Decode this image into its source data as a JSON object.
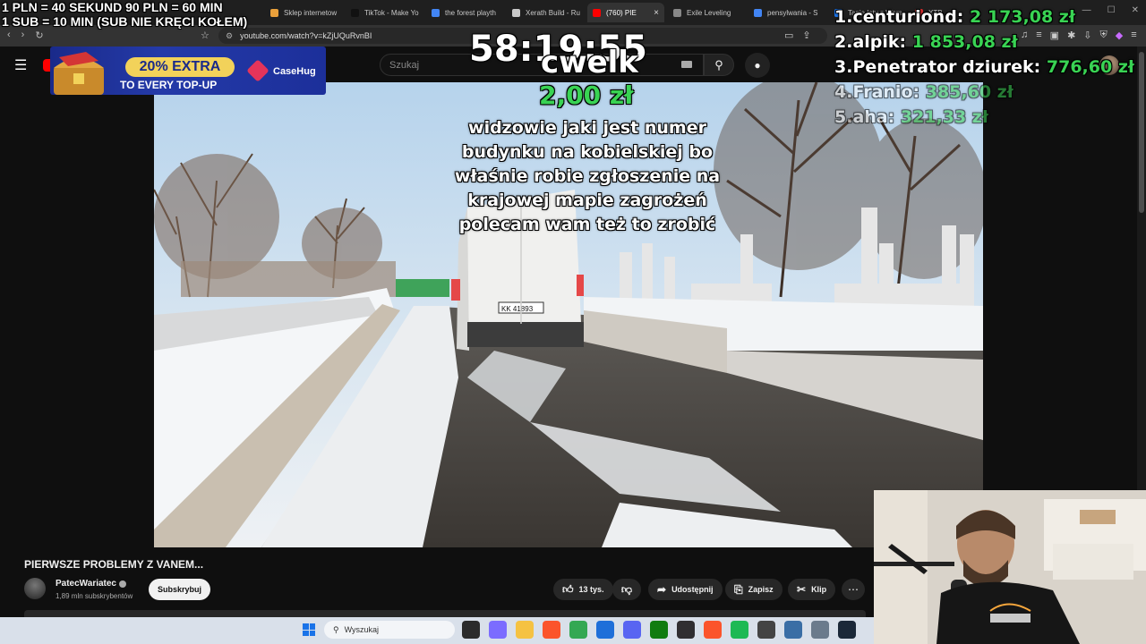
{
  "overlay": {
    "rate_line_1": "1 PLN =  40 SEKUND 90 PLN = 60 MIN",
    "rate_line_2": "1 SUB = 10 MIN (SUB NIE KRĘCI KOŁEM)",
    "timer": "58:19:55",
    "donation": {
      "name": "cwelk",
      "amount": "2,00 zł",
      "message": "widzowie jaki jest numer budynku na kobielskiej bo właśnie robie zgłoszenie na krajowej mapie zagrożeń polecam wam też to zrobić"
    },
    "leaderboard": [
      {
        "rank": "1.",
        "name": "centuriond:",
        "amount": "2 173,08 zł"
      },
      {
        "rank": "2.",
        "name": "alpik:",
        "amount": "1 853,08 zł"
      },
      {
        "rank": "3.",
        "name": "Penetrator dziurek:",
        "amount": "776,60 zł"
      },
      {
        "rank": "4.",
        "name": "Franio:",
        "amount": "385,60 zł"
      },
      {
        "rank": "5.",
        "name": "aha:",
        "amount": "321,33 zł"
      }
    ]
  },
  "browser": {
    "tabs": [
      {
        "label": "Sklep internetow",
        "color": "#e9a03b"
      },
      {
        "label": "TikTok - Make Yo",
        "color": "#111111"
      },
      {
        "label": "the forest playth",
        "color": "#4285f4"
      },
      {
        "label": "Xerath Build - Ru",
        "color": "#c9c9c9"
      },
      {
        "label": "(760) PIE",
        "color": "#ff0000",
        "active": true
      },
      {
        "label": "Exile Leveling",
        "color": "#888888"
      },
      {
        "label": "pensylwania - S",
        "color": "#4285f4"
      },
      {
        "label": "Tanie loty z Wars",
        "color": "#1a73e8"
      },
      {
        "label": "XTB",
        "color": "#d32f2f"
      }
    ],
    "url": "youtube.com/watch?v=kZjUQuRvnBI"
  },
  "youtube": {
    "search_placeholder": "Szukaj",
    "video_title": "PIERWSZE PROBLEMY Z VANEM...",
    "channel_name": "PatecWariatec",
    "subscribers": "1,89 mln subskrybentów",
    "subscribe_label": "Subskrybuj",
    "like_count": "13 tys.",
    "share_label": "Udostępnij",
    "save_label": "Zapisz",
    "clip_label": "Klip"
  },
  "ad": {
    "headline": "20% EXTRA",
    "subline": "TO EVERY TOP-UP",
    "brand": "CaseHug"
  },
  "video_scene": {
    "plate": "KK 41893"
  },
  "taskbar": {
    "search_label": "Wyszukaj",
    "apps": [
      {
        "name": "task-view",
        "color": "#2b2b2b"
      },
      {
        "name": "copilot",
        "color": "#7b6cff"
      },
      {
        "name": "file-explorer",
        "color": "#f5c242"
      },
      {
        "name": "brave",
        "color": "#fb542b"
      },
      {
        "name": "chrome",
        "color": "#34a853"
      },
      {
        "name": "store",
        "color": "#1e6fd9"
      },
      {
        "name": "discord",
        "color": "#5865f2"
      },
      {
        "name": "xbox",
        "color": "#107c10"
      },
      {
        "name": "obs",
        "color": "#302e31"
      },
      {
        "name": "brave-2",
        "color": "#fb542b"
      },
      {
        "name": "spotify",
        "color": "#1db954"
      },
      {
        "name": "notes",
        "color": "#444444"
      },
      {
        "name": "calculator",
        "color": "#3a6ea5"
      },
      {
        "name": "settings",
        "color": "#6b7b8c"
      },
      {
        "name": "steam",
        "color": "#1b2838"
      }
    ]
  }
}
